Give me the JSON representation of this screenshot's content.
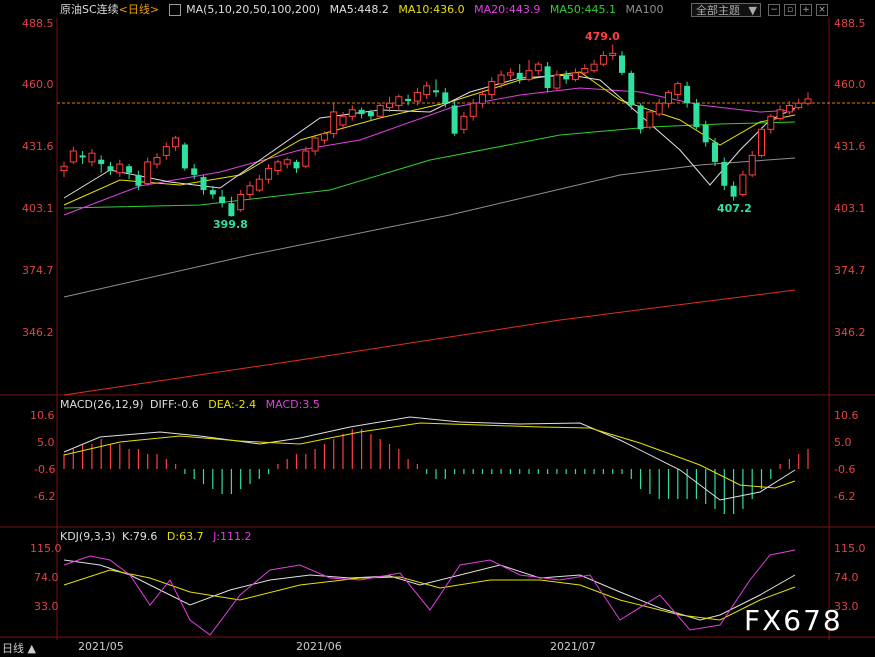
{
  "header": {
    "symbol": "原油SC连续",
    "period": "<日线>",
    "ma_label": "MA(5,10,20,50,100,200)",
    "ma_values": [
      {
        "label": "MA5:448.2",
        "color": "#e0e0e0"
      },
      {
        "label": "MA10:436.0",
        "color": "#e8e000"
      },
      {
        "label": "MA20:443.9",
        "color": "#e040e0"
      },
      {
        "label": "MA50:445.1",
        "color": "#30d030"
      },
      {
        "label": "MA100",
        "color": "#909090"
      }
    ],
    "theme_button": "全部主题"
  },
  "price_axis": [
    "488.5",
    "460.0",
    "431.6",
    "403.1",
    "374.7",
    "346.2"
  ],
  "annotations": {
    "high": "479.0",
    "low1": "399.8",
    "low2": "407.2"
  },
  "macd": {
    "title": "MACD(26,12,9)",
    "diff": "DIFF:-0.6",
    "dea": "DEA:-2.4",
    "macd": "MACD:3.5",
    "axis": [
      "10.6",
      "5.0",
      "-0.6",
      "-6.2"
    ]
  },
  "kdj": {
    "title": "KDJ(9,3,3)",
    "k": "K:79.6",
    "d": "D:63.7",
    "j": "J:111.2",
    "axis": [
      "115.0",
      "74.0",
      "33.0"
    ]
  },
  "dates": [
    "2021/05",
    "2021/06",
    "2021/07"
  ],
  "footer_tab": "日线 ▲",
  "watermark": "FX678",
  "colors": {
    "up": "#ff4040",
    "down": "#30e0a0",
    "ma5": "#e0e0e0",
    "ma10": "#e8e000",
    "ma20": "#e040e0",
    "ma50": "#30d030",
    "ma100": "#909090",
    "ma200": "#e03020"
  }
}
